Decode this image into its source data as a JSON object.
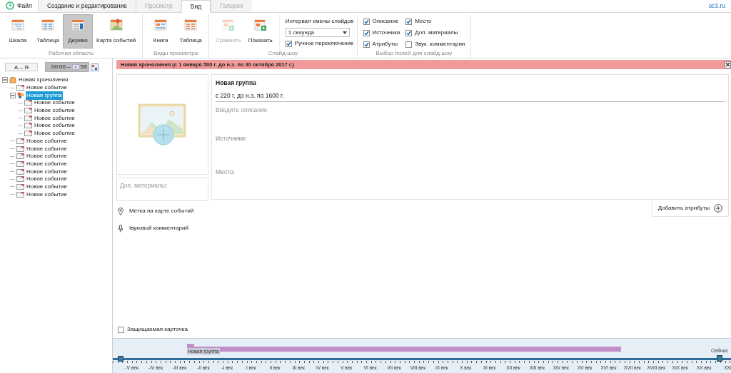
{
  "menu": {
    "file": "Файл",
    "tabs": [
      {
        "label": "Создание и редактирование",
        "selected": false,
        "disabled": false
      },
      {
        "label": "Просмотр",
        "selected": false,
        "disabled": true
      },
      {
        "label": "Вид",
        "selected": true,
        "disabled": false
      },
      {
        "label": "Галерея",
        "selected": false,
        "disabled": true
      }
    ],
    "site": "oc3.ru"
  },
  "ribbon": {
    "groups": [
      {
        "title": "Рабочая область",
        "buttons": [
          {
            "label": "Шкала",
            "kind": "scale",
            "selected": false,
            "disabled": false
          },
          {
            "label": "Таблица",
            "kind": "table",
            "selected": false,
            "disabled": false
          },
          {
            "label": "Дерево",
            "kind": "tree",
            "selected": true,
            "disabled": false
          },
          {
            "label": "Карта событий",
            "kind": "map",
            "selected": false,
            "disabled": false
          }
        ]
      },
      {
        "title": "Виды просмотра",
        "buttons": [
          {
            "label": "Книга",
            "kind": "book",
            "selected": false,
            "disabled": false
          },
          {
            "label": "Таблица",
            "kind": "grid",
            "selected": false,
            "disabled": false
          }
        ]
      },
      {
        "title": "Слайд-шоу",
        "buttons": [
          {
            "label": "Сравнить",
            "kind": "play",
            "selected": false,
            "disabled": true
          },
          {
            "label": "Показать",
            "kind": "play",
            "selected": false,
            "disabled": false
          }
        ],
        "interval_label": "Интервал смены слайдов",
        "interval": "1 секунда",
        "manual": {
          "label": "Ручное переключение",
          "checked": true
        }
      },
      {
        "title": "Выбор полей для слайд-шоу",
        "fields": [
          {
            "label": "Описание",
            "checked": true
          },
          {
            "label": "Источники",
            "checked": true
          },
          {
            "label": "Атрибуты",
            "checked": true
          },
          {
            "label": "Место",
            "checked": true
          },
          {
            "label": "Доп. материалы",
            "checked": true
          },
          {
            "label": "Звук. комментарии",
            "checked": false
          }
        ]
      }
    ]
  },
  "sidebar": {
    "sort": "А – Я",
    "time": "00:00 –",
    "time_end": "59",
    "tree": [
      {
        "label": "Новая хронолиния",
        "kind": "timeline",
        "selected": false,
        "expanded": true,
        "children": [
          {
            "label": "Новое событие",
            "kind": "event",
            "selected": false
          },
          {
            "label": "Новая группа",
            "kind": "group",
            "selected": true,
            "expanded": true,
            "children": [
              {
                "label": "Новое событие",
                "kind": "event",
                "selected": false
              },
              {
                "label": "Новое событие",
                "kind": "event",
                "selected": false
              },
              {
                "label": "Новое событие",
                "kind": "event",
                "selected": false
              },
              {
                "label": "Новое событие",
                "kind": "event",
                "selected": false
              },
              {
                "label": "Новое событие",
                "kind": "event",
                "selected": false
              }
            ]
          },
          {
            "label": "Новое событие",
            "kind": "event",
            "selected": false
          },
          {
            "label": "Новое событие",
            "kind": "event",
            "selected": false
          },
          {
            "label": "Новое событие",
            "kind": "event",
            "selected": false
          },
          {
            "label": "Новое событие",
            "kind": "event",
            "selected": false
          },
          {
            "label": "Новое событие",
            "kind": "event",
            "selected": false
          },
          {
            "label": "Новое событие",
            "kind": "event",
            "selected": false
          },
          {
            "label": "Новое событие",
            "kind": "event",
            "selected": false
          },
          {
            "label": "Новое событие",
            "kind": "event",
            "selected": false
          }
        ]
      }
    ]
  },
  "header": "Новая хронолиния (с 1 января 500 г. до н.э. по 30 октября 2017 г.)",
  "card": {
    "title": "Новая группа",
    "dates": "с 220 г. до н.э. по 1600 г.",
    "description_placeholder": "Введите описание",
    "sources": "Источники:",
    "place": "Место:",
    "extras": "Доп. материалы:",
    "map_mark": "Метка на карте событий",
    "audio": "Івуковой комментарий",
    "add_attributes": "Добавить атрибуты",
    "protected": {
      "label": "Защищаемая карточка",
      "checked": false
    }
  },
  "timeline": {
    "bar_label": "Новая группа",
    "now": "Сейчас",
    "labels": [
      "-V век",
      "-IV век",
      "-III век",
      "-II век",
      "-I век",
      "I век",
      "II век",
      "III век",
      "IV век",
      "V век",
      "VI век",
      "VII век",
      "VIII век",
      "IX век",
      "X век",
      "XI век",
      "XII век",
      "XIII век",
      "XIV век",
      "XV век",
      "XVI век",
      "XVII век",
      "XVIII век",
      "XIX век",
      "XX век",
      "XXI"
    ]
  }
}
